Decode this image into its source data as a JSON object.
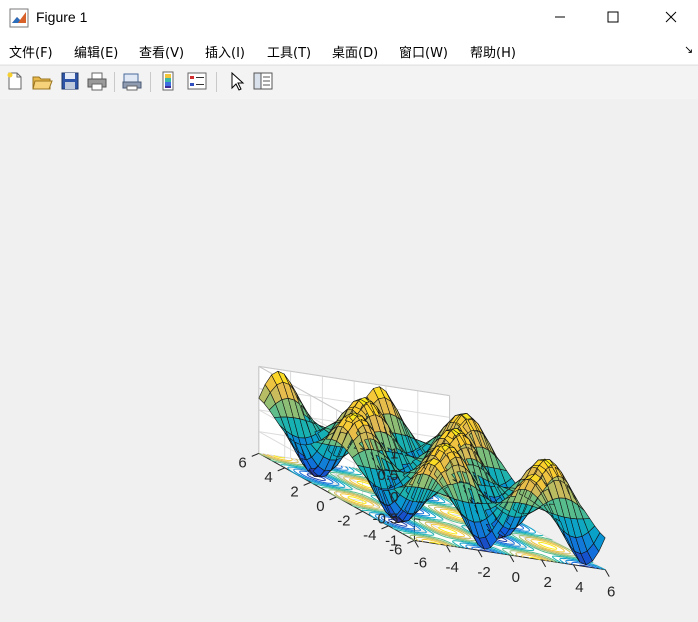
{
  "window": {
    "title": "Figure 1"
  },
  "menu": {
    "items": [
      "文件(F)",
      "编辑(E)",
      "查看(V)",
      "插入(I)",
      "工具(T)",
      "桌面(D)",
      "窗口(W)",
      "帮助(H)"
    ]
  },
  "toolbar": {
    "buttons": [
      "new-figure",
      "open-file",
      "save",
      "print",
      "print-preview",
      "insert-colorbar",
      "insert-legend",
      "edit-plot",
      "property-inspector"
    ]
  },
  "chart_data": {
    "type": "surface",
    "function": "sin(x)*cos(y)",
    "x_range": [
      -6,
      6
    ],
    "y_range": [
      -6,
      6
    ],
    "z_range": [
      -1,
      1
    ],
    "z_ticks": [
      "1",
      "0.5",
      "0",
      "-0.5",
      "-1"
    ],
    "x_ticks": [
      "-6",
      "-4",
      "-2",
      "0",
      "2",
      "4",
      "6"
    ],
    "y_ticks": [
      "-6",
      "-4",
      "-2",
      "0",
      "2",
      "4",
      "6"
    ],
    "contour_below": true,
    "colormap": "parula",
    "grid": true
  }
}
